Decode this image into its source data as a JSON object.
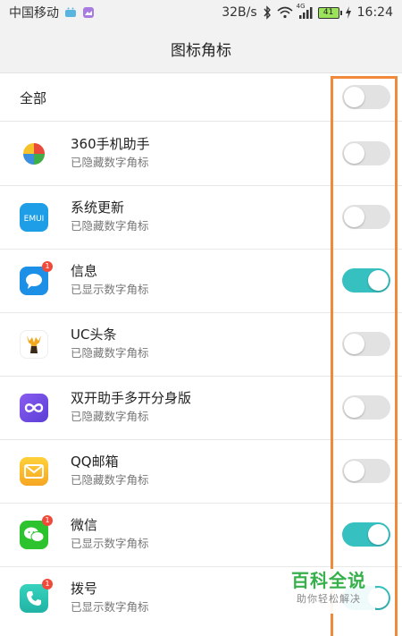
{
  "status_bar": {
    "carrier": "中国移动",
    "speed": "32B/s",
    "network": "4G",
    "battery": "41",
    "time": "16:24"
  },
  "header": {
    "title": "图标角标"
  },
  "all_row": {
    "label": "全部",
    "enabled": false
  },
  "apps": [
    {
      "name": "360手机助手",
      "status": "已隐藏数字角标",
      "enabled": false,
      "icon": "360-helper-icon",
      "badge": ""
    },
    {
      "name": "系统更新",
      "status": "已隐藏数字角标",
      "enabled": false,
      "icon": "emui-update-icon",
      "badge": ""
    },
    {
      "name": "信息",
      "status": "已显示数字角标",
      "enabled": true,
      "icon": "messages-icon",
      "badge": "1"
    },
    {
      "name": "UC头条",
      "status": "已隐藏数字角标",
      "enabled": false,
      "icon": "uc-headlines-icon",
      "badge": ""
    },
    {
      "name": "双开助手多开分身版",
      "status": "已隐藏数字角标",
      "enabled": false,
      "icon": "dual-app-icon",
      "badge": ""
    },
    {
      "name": "QQ邮箱",
      "status": "已隐藏数字角标",
      "enabled": false,
      "icon": "qq-mail-icon",
      "badge": ""
    },
    {
      "name": "微信",
      "status": "已显示数字角标",
      "enabled": true,
      "icon": "wechat-icon",
      "badge": "1"
    },
    {
      "name": "拨号",
      "status": "已显示数字角标",
      "enabled": true,
      "icon": "phone-dialer-icon",
      "badge": "1"
    }
  ],
  "watermark": {
    "title": "百科全说",
    "subtitle": "助你轻松解决"
  },
  "colors": {
    "toggle_on": "#36c0c0",
    "toggle_off": "#e2e2e2",
    "highlight": "#f08a3a",
    "badge": "#f04b3a"
  }
}
